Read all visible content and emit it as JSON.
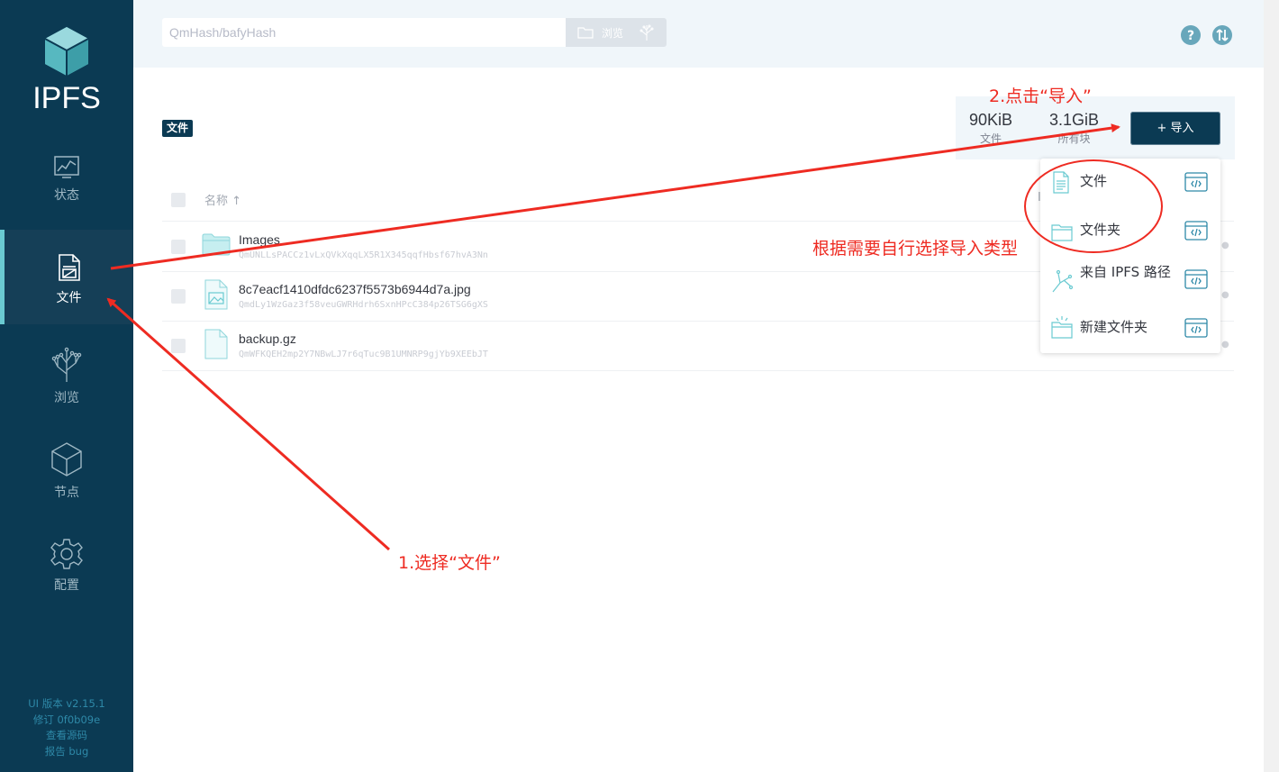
{
  "app": {
    "logo_text": "IPFS",
    "accent_color": "#0b3a53",
    "highlight_color": "#6acad1"
  },
  "sidebar": {
    "items": [
      {
        "label": "状态",
        "icon": "status-chart-icon"
      },
      {
        "label": "文件",
        "icon": "files-icon",
        "active": true
      },
      {
        "label": "浏览",
        "icon": "explore-tree-icon"
      },
      {
        "label": "节点",
        "icon": "peers-cube-icon"
      },
      {
        "label": "配置",
        "icon": "settings-gear-icon"
      }
    ],
    "version": "UI 版本 v2.15.1",
    "revision": "修订 0f0b09e",
    "source_link": "查看源码",
    "report_link": "报告 bug"
  },
  "topbar": {
    "search_placeholder": "QmHash/bafyHash",
    "browse_label": "浏览"
  },
  "main": {
    "breadcrumb": "文件",
    "stats": [
      {
        "value": "90KiB",
        "label": "文件"
      },
      {
        "value": "3.1GiB",
        "label": "所有块"
      }
    ],
    "import_label": "+ 导入",
    "list_header": {
      "name_col": "名称 ↑",
      "extra_col": "I"
    },
    "files": [
      {
        "name": "Images",
        "hash": "QmUNLLsPACCz1vLxQVkXqqLX5R1X345qqfHbsf67hvA3Nn",
        "type": "folder"
      },
      {
        "name": "8c7eacf1410dfdc6237f5573b6944d7a.jpg",
        "hash": "QmdLy1WzGaz3f58veuGWRHdrh6SxnHPcC384p26TSG6gXS",
        "type": "image"
      },
      {
        "name": "backup.gz",
        "hash": "QmWFKQEH2mp2Y7NBwLJ7r6qTuc9B1UMNRP9gjYb9XEEbJT",
        "type": "file"
      }
    ]
  },
  "dropdown": {
    "items": [
      {
        "label": "文件",
        "icon": "document-icon"
      },
      {
        "label": "文件夹",
        "icon": "folder-icon"
      },
      {
        "label": "来自 IPFS 路径",
        "icon": "ipfs-path-icon"
      },
      {
        "label": "新建文件夹",
        "icon": "new-folder-icon"
      }
    ]
  },
  "annotations": {
    "step1": "1.选择“文件”",
    "step2": "2.点击“导入”",
    "note": "根据需要自行选择导入类型"
  }
}
